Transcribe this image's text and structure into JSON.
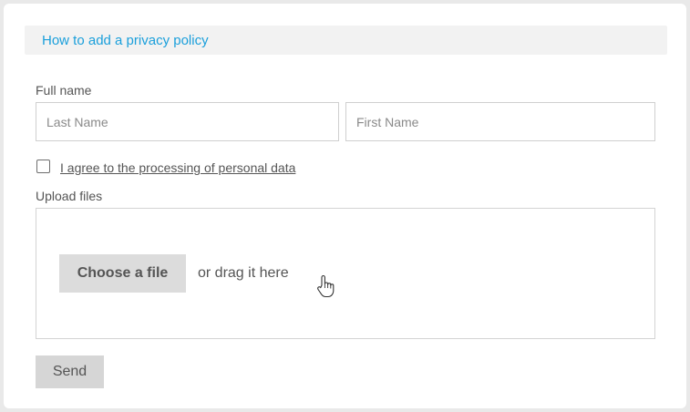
{
  "info_bar": {
    "link_text": "How to add a privacy policy"
  },
  "full_name": {
    "label": "Full name",
    "last_name_placeholder": "Last Name",
    "last_name_value": "",
    "first_name_placeholder": "First Name",
    "first_name_value": ""
  },
  "consent": {
    "checked": false,
    "label": "I agree to the processing of personal data"
  },
  "upload": {
    "label": "Upload files",
    "choose_button": "Choose a file",
    "drag_text": "or drag it here",
    "cursor_icon": "hand-pointer-icon"
  },
  "form": {
    "send_button": "Send"
  },
  "colors": {
    "link": "#1a9fdb",
    "text": "#555555",
    "button_bg": "#dcdcdc",
    "border": "#cfcfcf"
  }
}
